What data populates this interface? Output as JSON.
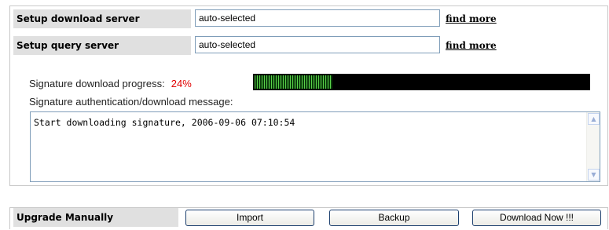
{
  "servers": {
    "download": {
      "label": "Setup download server",
      "value": "auto-selected",
      "link": "find more"
    },
    "query": {
      "label": "Setup query server",
      "value": "auto-selected",
      "link": "find more"
    }
  },
  "progress": {
    "label": "Signature download progress:",
    "percent_text": "24%",
    "fraction": 0.24,
    "bar_color": "#5ad24a"
  },
  "auth": {
    "label": "Signature authentication/download message:",
    "message": "Start downloading signature, 2006-09-06 07:10:54"
  },
  "upgrade": {
    "label": "Upgrade Manually",
    "import_label": "Import",
    "backup_label": "Backup",
    "download_label": "Download Now !!!"
  },
  "colors": {
    "percent": "#e00000",
    "label_bg": "#e0e0e0",
    "progress_track": "#000000"
  }
}
